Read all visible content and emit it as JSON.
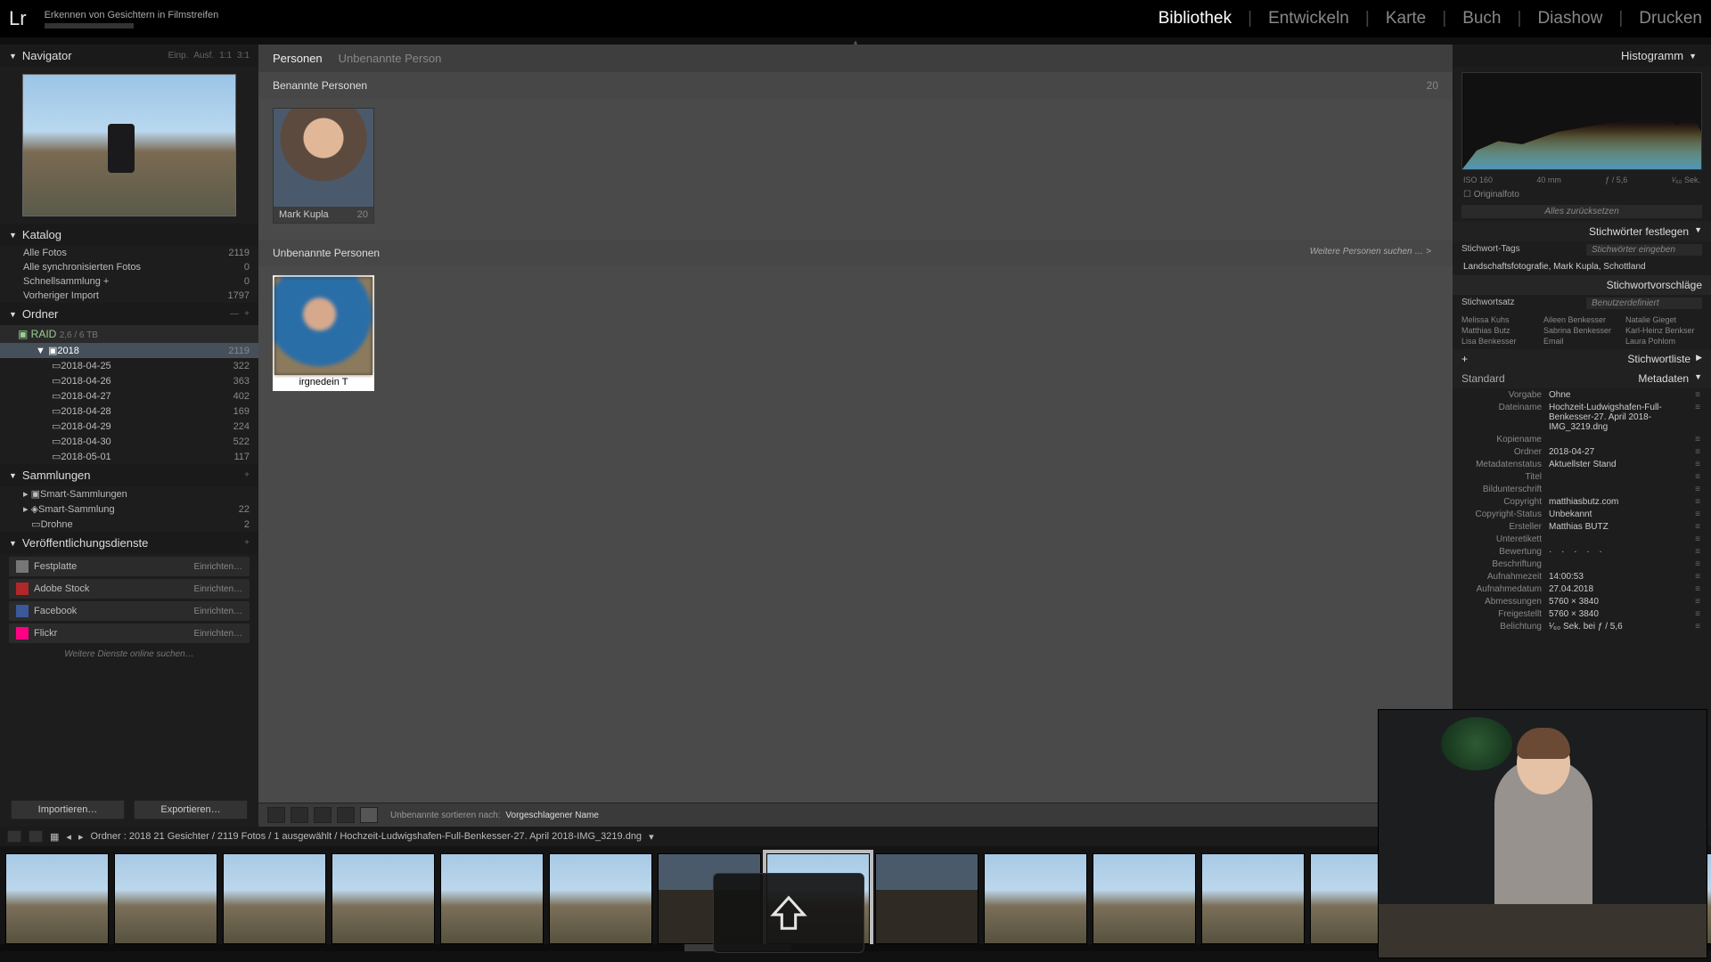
{
  "app": {
    "logo": "Lr",
    "task": "Erkennen von Gesichtern in Filmstreifen"
  },
  "modules": {
    "items": [
      "Bibliothek",
      "Entwickeln",
      "Karte",
      "Buch",
      "Diashow",
      "Drucken"
    ],
    "active": "Bibliothek"
  },
  "left": {
    "navigator": {
      "title": "Navigator",
      "modes": [
        "Einp.",
        "Ausf.",
        "1:1",
        "3:1"
      ]
    },
    "katalog": {
      "title": "Katalog",
      "rows": [
        {
          "label": "Alle Fotos",
          "count": "2119"
        },
        {
          "label": "Alle synchronisierten Fotos",
          "count": "0"
        },
        {
          "label": "Schnellsammlung  +",
          "count": "0"
        },
        {
          "label": "Vorheriger Import",
          "count": "1797"
        }
      ]
    },
    "ordner": {
      "title": "Ordner",
      "volume": {
        "name": "RAID",
        "stat": "2,6 / 6 TB"
      },
      "year": {
        "label": "2018",
        "count": "2119"
      },
      "folders": [
        {
          "label": "2018-04-25",
          "count": "322"
        },
        {
          "label": "2018-04-26",
          "count": "363"
        },
        {
          "label": "2018-04-27",
          "count": "402"
        },
        {
          "label": "2018-04-28",
          "count": "169"
        },
        {
          "label": "2018-04-29",
          "count": "224"
        },
        {
          "label": "2018-04-30",
          "count": "522"
        },
        {
          "label": "2018-05-01",
          "count": "117"
        }
      ]
    },
    "sammlungen": {
      "title": "Sammlungen",
      "rows": [
        {
          "label": "Smart-Sammlungen",
          "count": ""
        },
        {
          "label": "Smart-Sammlung",
          "count": "22"
        },
        {
          "label": "Drohne",
          "count": "2"
        }
      ]
    },
    "publish": {
      "title": "Veröffentlichungsdienste",
      "rows": [
        {
          "icon": "#777",
          "label": "Festplatte",
          "setup": "Einrichten…"
        },
        {
          "icon": "#b02828",
          "label": "Adobe Stock",
          "setup": "Einrichten…"
        },
        {
          "icon": "#3b5998",
          "label": "Facebook",
          "setup": "Einrichten…"
        },
        {
          "icon": "#ff0084",
          "label": "Flickr",
          "setup": "Einrichten…"
        }
      ],
      "more": "Weitere Dienste online suchen…"
    },
    "buttons": {
      "import": "Importieren…",
      "export": "Exportieren…"
    }
  },
  "center": {
    "breadcrumb": {
      "a": "Personen",
      "b": "Unbenannte Person"
    },
    "named": {
      "title": "Benannte Personen",
      "count": "20",
      "faces": [
        {
          "name": "Mark Kupla",
          "count": "20"
        }
      ]
    },
    "unnamed": {
      "title": "Unbenannte Personen",
      "more": "Weitere Personen suchen …  >",
      "input_value": "irgnedein T"
    },
    "toolbar": {
      "sort_label": "Unbenannte sortieren nach:",
      "sort_value": "Vorgeschlagener Name"
    }
  },
  "right": {
    "histogram": {
      "title": "Histogramm",
      "iso": "ISO 160",
      "lens": "40 mm",
      "ap": "ƒ / 5,6",
      "sh": "¹⁄₆₀ Sek.",
      "orig": "Originalfoto",
      "reset": "Alles zurücksetzen"
    },
    "keywords_panel": {
      "title": "Stichwörter festlegen",
      "tags_label": "Stichwort-Tags",
      "tags_placeholder": "Stichwörter eingeben",
      "current": "Landschaftsfotografie, Mark Kupla, Schottland"
    },
    "kw_sugg_title": "Stichwortvorschläge",
    "kw_set": {
      "label": "Stichwortsatz",
      "value": "Benutzerdefiniert"
    },
    "kw_sugg": [
      "Melissa Kuhs",
      "Aileen Benkesser",
      "Natalie Gieget",
      "Matthias Butz",
      "Sabrina Benkesser",
      "Karl-Heinz Benkser",
      "Lisa Benkesser",
      "Email",
      "Laura Pohlom"
    ],
    "kw_list_title": "Stichwortliste",
    "metadata": {
      "title": "Metadaten",
      "mode_l": "Standard",
      "mode_r": "Metadaten",
      "rows": [
        {
          "k": "Vorgabe",
          "v": "Ohne"
        },
        {
          "k": "Dateiname",
          "v": "Hochzeit-Ludwigshafen-Full-Benkesser-27. April 2018-IMG_3219.dng"
        },
        {
          "k": "Kopiename",
          "v": ""
        },
        {
          "k": "Ordner",
          "v": "2018-04-27"
        },
        {
          "k": "Metadatenstatus",
          "v": "Aktuellster Stand"
        },
        {
          "k": "Titel",
          "v": ""
        },
        {
          "k": "Bildunterschrift",
          "v": ""
        },
        {
          "k": "Copyright",
          "v": "matthiasbutz.com"
        },
        {
          "k": "Copyright-Status",
          "v": "Unbekannt"
        },
        {
          "k": "Ersteller",
          "v": "Matthias BUTZ"
        },
        {
          "k": "Unteretikett",
          "v": ""
        },
        {
          "k": "Bewertung",
          "v": "·  ·  ·  ·  ·"
        },
        {
          "k": "Beschriftung",
          "v": ""
        },
        {
          "k": "Aufnahmezeit",
          "v": "14:00:53"
        },
        {
          "k": "Aufnahmedatum",
          "v": "27.04.2018"
        },
        {
          "k": "Abmessungen",
          "v": "5760 × 3840"
        },
        {
          "k": "Freigestellt",
          "v": "5760 × 3840"
        },
        {
          "k": "Belichtung",
          "v": "¹⁄₆₀ Sek. bei ƒ / 5,6"
        }
      ]
    }
  },
  "info_strip": "Ordner : 2018   21 Gesichter / 2119 Fotos / 1 ausgewählt /  Hochzeit-Ludwigshafen-Full-Benkesser-27. April 2018-IMG_3219.dng",
  "filmstrip_count": 16
}
